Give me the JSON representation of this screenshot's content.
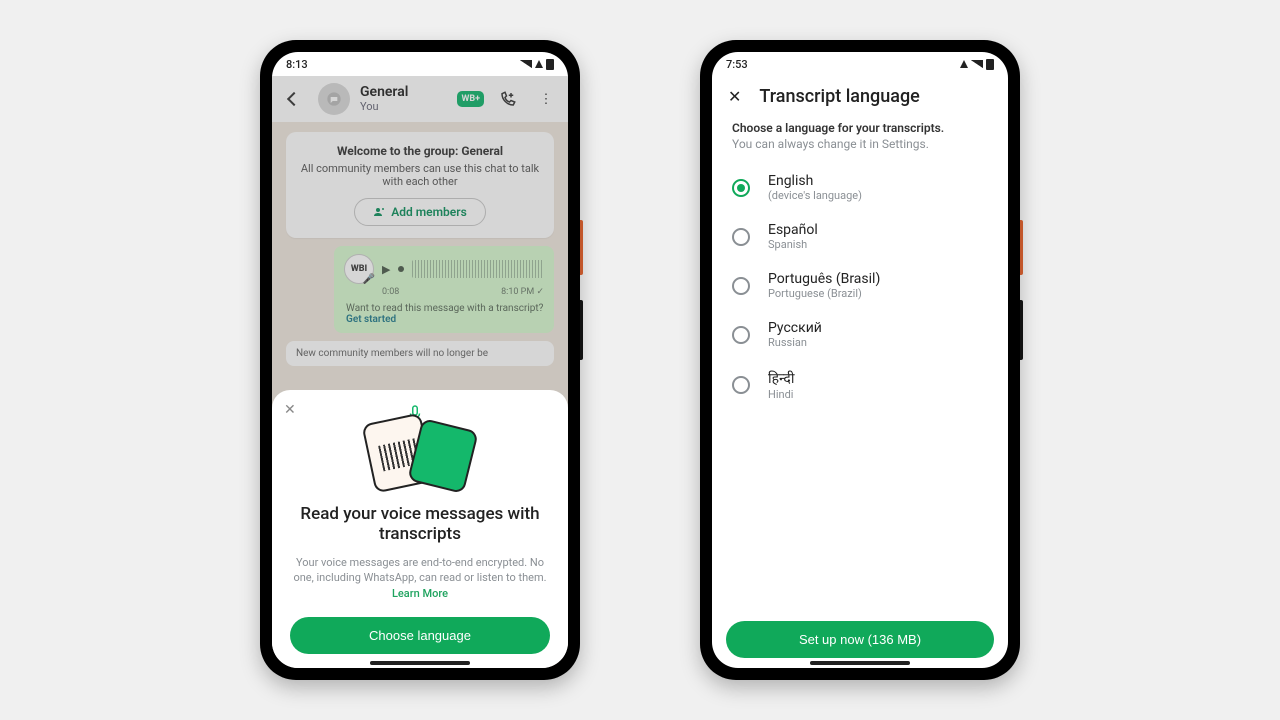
{
  "left": {
    "status_time": "8:13",
    "header": {
      "title": "General",
      "subtitle": "You"
    },
    "system_card": {
      "title": "Welcome to the group: General",
      "body": "All community members can use this chat to talk with each other",
      "add_members": "Add members"
    },
    "voice": {
      "avatar_label": "WBI",
      "duration": "0:08",
      "time": "8:10 PM",
      "prompt": "Want to read this message with a transcript?",
      "get_started": "Get started"
    },
    "system2": "New community members will no longer be",
    "sheet": {
      "heading": "Read your voice messages with transcripts",
      "body": "Your voice messages are end-to-end encrypted. No one, including WhatsApp, can read or listen to them.",
      "learn_more": "Learn More",
      "cta": "Choose language"
    }
  },
  "right": {
    "status_time": "7:53",
    "title": "Transcript language",
    "sub1": "Choose a language for your transcripts.",
    "sub2": "You can always change it in Settings.",
    "options": [
      {
        "name": "English",
        "sub": "(device's language)",
        "selected": true
      },
      {
        "name": "Español",
        "sub": "Spanish",
        "selected": false
      },
      {
        "name": "Português (Brasil)",
        "sub": "Portuguese (Brazil)",
        "selected": false
      },
      {
        "name": "Русский",
        "sub": "Russian",
        "selected": false
      },
      {
        "name": "हिन्दी",
        "sub": "Hindi",
        "selected": false
      }
    ],
    "cta": "Set up now (136 MB)"
  }
}
